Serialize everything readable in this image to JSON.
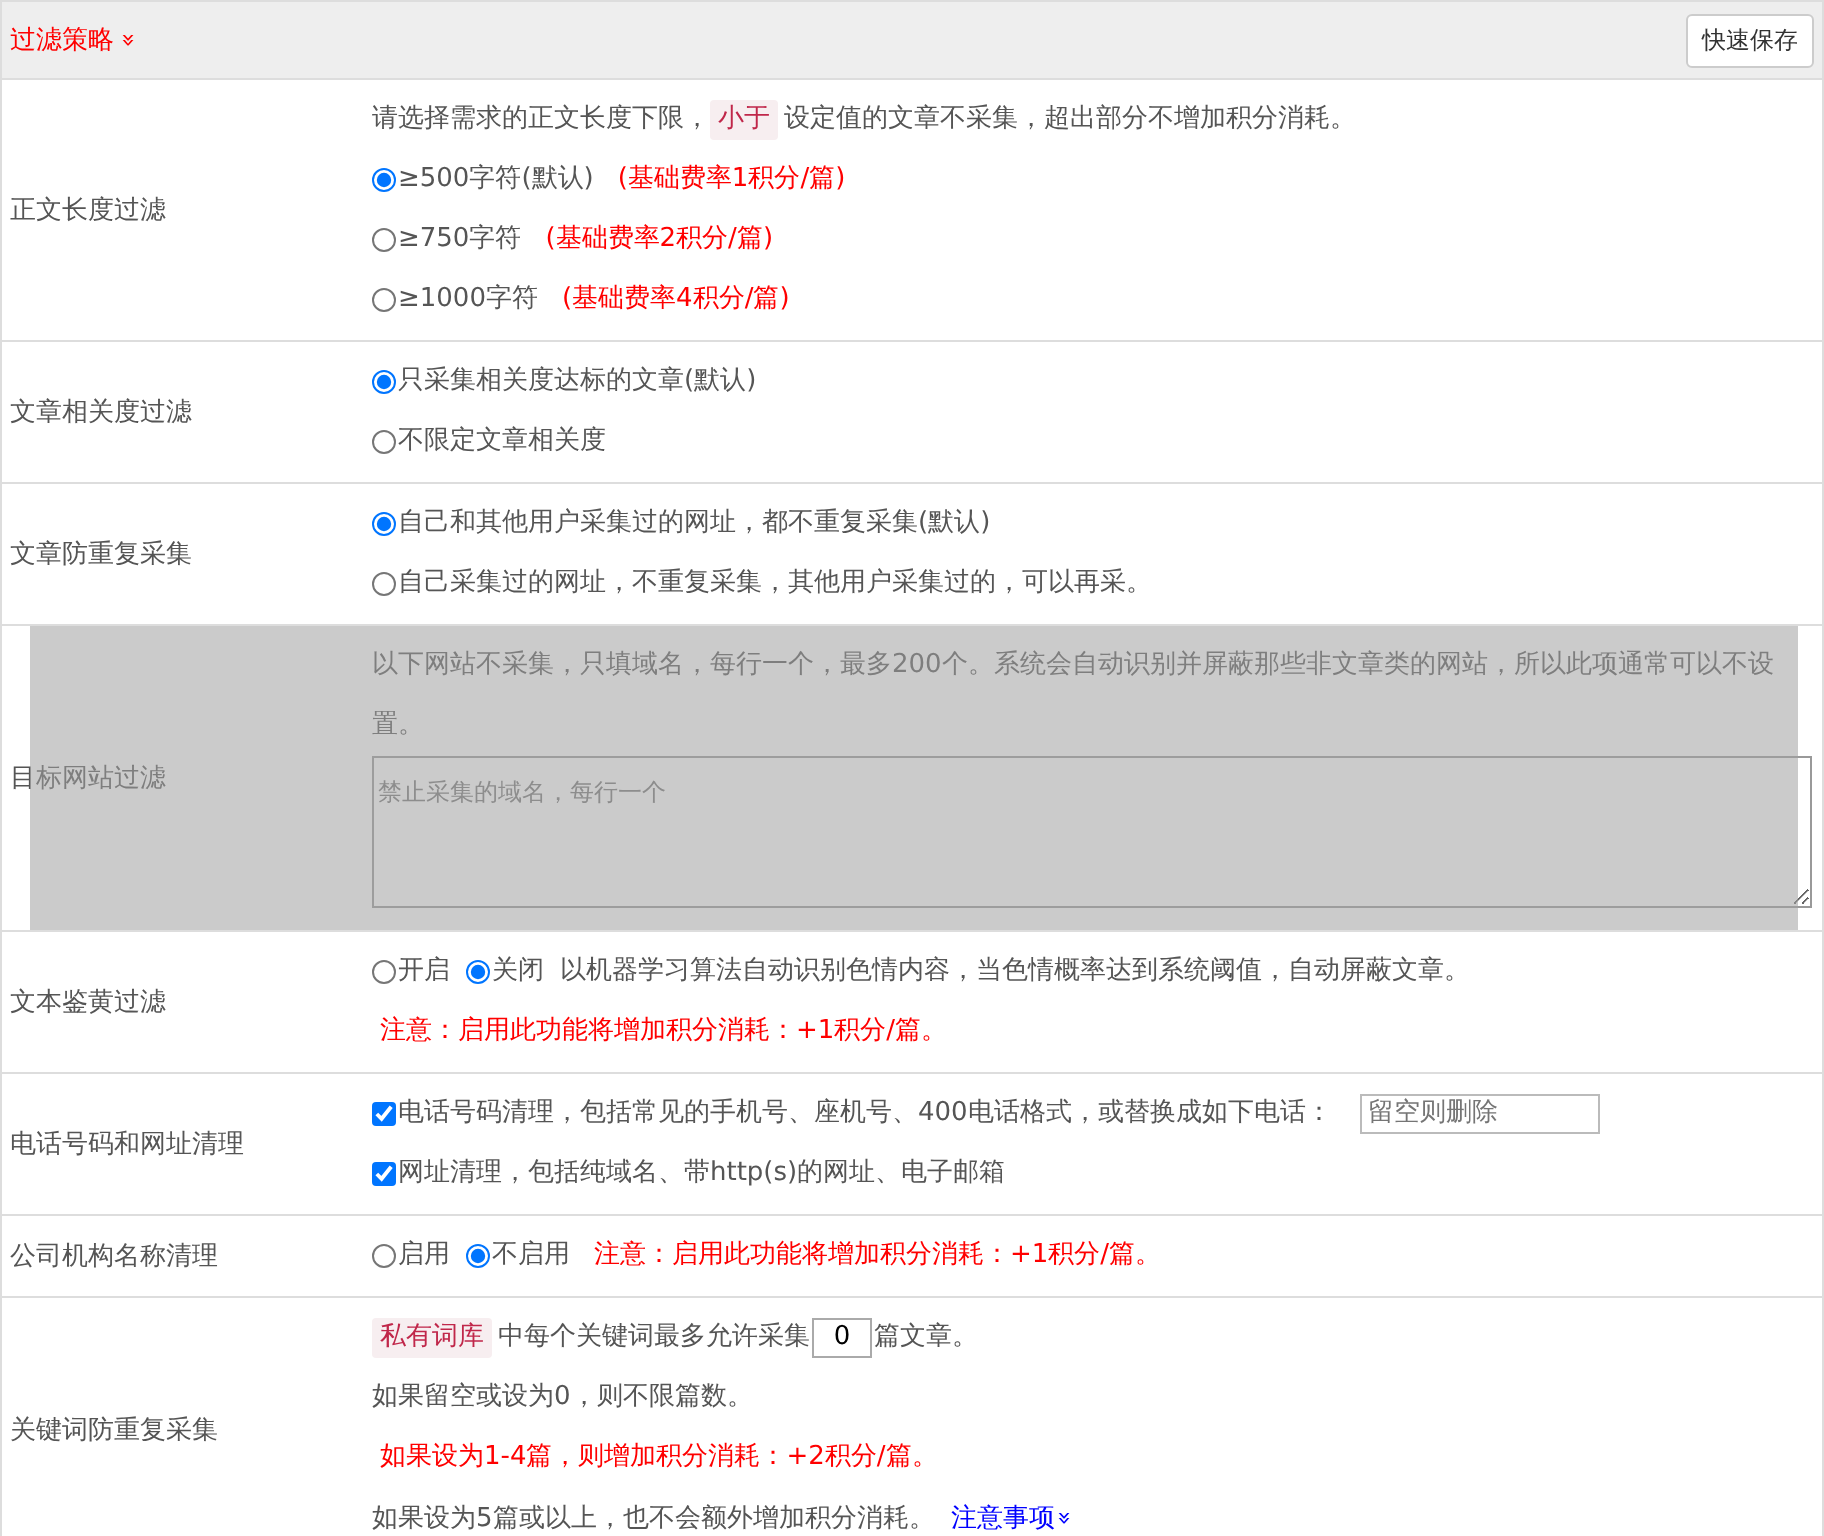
{
  "header": {
    "title": "过滤策略",
    "title_icon": "»",
    "save_button": "快速保存"
  },
  "rows": [
    {
      "label": "正文长度过滤",
      "disabled": false,
      "lines": [
        {
          "parts": [
            {
              "kind": "text",
              "text": "请选择需求的正文长度下限，"
            },
            {
              "kind": "tag",
              "text": "小于"
            },
            {
              "kind": "text",
              "text": "设定值的文章不采集，超出部分不增加积分消耗。"
            }
          ]
        },
        {
          "parts": [
            {
              "kind": "radio",
              "text": "≥500字符(默认)",
              "selected": true
            },
            {
              "kind": "note",
              "text": "(基础费率1积分/篇)"
            }
          ]
        },
        {
          "parts": [
            {
              "kind": "radio",
              "text": "≥750字符",
              "selected": false
            },
            {
              "kind": "note",
              "text": "(基础费率2积分/篇)"
            }
          ]
        },
        {
          "parts": [
            {
              "kind": "radio",
              "text": "≥1000字符",
              "selected": false
            },
            {
              "kind": "note",
              "text": "(基础费率4积分/篇)"
            }
          ]
        }
      ]
    },
    {
      "label": "文章相关度过滤",
      "disabled": false,
      "lines": [
        {
          "parts": [
            {
              "kind": "radio",
              "text": "只采集相关度达标的文章(默认)",
              "selected": true
            }
          ]
        },
        {
          "parts": [
            {
              "kind": "radio",
              "text": "不限定文章相关度",
              "selected": false
            }
          ]
        }
      ]
    },
    {
      "label": "文章防重复采集",
      "disabled": false,
      "lines": [
        {
          "parts": [
            {
              "kind": "radio",
              "text": "自己和其他用户采集过的网址，都不重复采集(默认)",
              "selected": true
            }
          ]
        },
        {
          "parts": [
            {
              "kind": "radio",
              "text": "自己采集过的网址，不重复采集，其他用户采集过的，可以再采。",
              "selected": false
            }
          ]
        }
      ]
    },
    {
      "label": "目标网站过滤",
      "disabled": true,
      "lines": [
        {
          "parts": [
            {
              "kind": "text",
              "text": "以下网站不采集，只填域名，每行一个，最多200个。系统会自动识别并屏蔽那些非文章类的网站，所以此项通常可以不设置。"
            }
          ]
        },
        {
          "parts": [
            {
              "kind": "textarea",
              "placeholder": "禁止采集的域名，每行一个"
            }
          ]
        }
      ]
    },
    {
      "label": "文本鉴黄过滤",
      "disabled": false,
      "lines": [
        {
          "parts": [
            {
              "kind": "radio",
              "text": "开启",
              "selected": false
            },
            {
              "kind": "radio",
              "text": "关闭",
              "selected": true
            },
            {
              "kind": "text",
              "text": "以机器学习算法自动识别色情内容，当色情概率达到系统阈值，自动屏蔽文章。"
            }
          ]
        },
        {
          "parts": [
            {
              "kind": "note",
              "text": "注意：启用此功能将增加积分消耗：+1积分/篇。"
            }
          ]
        }
      ]
    },
    {
      "label": "电话号码和网址清理",
      "disabled": false,
      "lines": [
        {
          "parts": [
            {
              "kind": "checkbox",
              "text": "电话号码清理，包括常见的手机号、座机号、400电话格式，或替换成如下电话：",
              "checked": true
            },
            {
              "kind": "input",
              "placeholder": "留空则删除"
            }
          ]
        },
        {
          "parts": [
            {
              "kind": "checkbox",
              "text": "网址清理，包括纯域名、带http(s)的网址、电子邮箱",
              "checked": true
            }
          ]
        }
      ]
    },
    {
      "label": "公司机构名称清理",
      "disabled": false,
      "lines": [
        {
          "parts": [
            {
              "kind": "radio",
              "text": "启用",
              "selected": false
            },
            {
              "kind": "radio",
              "text": "不启用",
              "selected": true
            },
            {
              "kind": "note",
              "text": "注意：启用此功能将增加积分消耗：+1积分/篇。"
            }
          ]
        }
      ]
    },
    {
      "label": "关键词防重复采集",
      "disabled": false,
      "lines": [
        {
          "parts": [
            {
              "kind": "tag",
              "text": "私有词库"
            },
            {
              "kind": "text",
              "text": "中每个关键词最多允许采集"
            },
            {
              "kind": "number",
              "value": "0"
            },
            {
              "kind": "text",
              "text": "篇文章。"
            }
          ]
        },
        {
          "parts": [
            {
              "kind": "text",
              "text": "如果留空或设为0，则不限篇数。"
            }
          ]
        },
        {
          "parts": [
            {
              "kind": "note",
              "text": "如果设为1-4篇，则增加积分消耗：+2积分/篇。"
            }
          ]
        },
        {
          "parts": [
            {
              "kind": "text",
              "text": "如果设为5篇或以上，也不会额外增加积分消耗。"
            },
            {
              "kind": "link",
              "text": "注意事项",
              "icon": "»"
            }
          ]
        }
      ]
    }
  ]
}
